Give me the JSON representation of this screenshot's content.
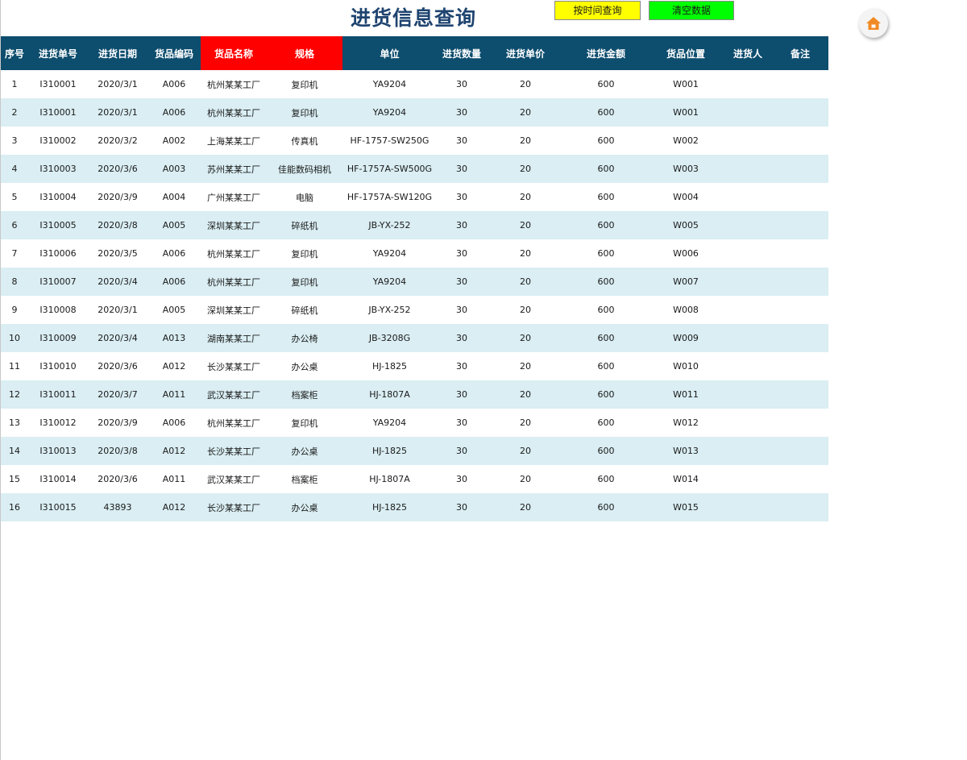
{
  "title": "进货信息查询",
  "buttons": {
    "query_by_time": "按时间查询",
    "clear_data": "清空数据"
  },
  "icons": {
    "home": "home-icon"
  },
  "colors": {
    "title": "#1f4470",
    "header_bg": "#0d4d6e",
    "header_highlight": "#ff0000",
    "stripe": "#daeef3",
    "query_button": "#ffff00",
    "clear_button": "#00ff00",
    "home_icon": "#f08a24"
  },
  "table": {
    "columns": [
      "序号",
      "进货单号",
      "进货日期",
      "货品编码",
      "货品名称",
      "规格",
      "单位",
      "进货数量",
      "进货单价",
      "进货金额",
      "货品位置",
      "进货人",
      "备注"
    ],
    "highlighted_columns": [
      4,
      5
    ],
    "rows": [
      [
        "1",
        "I310001",
        "2020/3/1",
        "A006",
        "杭州某某工厂",
        "复印机",
        "YA9204",
        "30",
        "20",
        "600",
        "W001",
        "",
        ""
      ],
      [
        "2",
        "I310001",
        "2020/3/1",
        "A006",
        "杭州某某工厂",
        "复印机",
        "YA9204",
        "30",
        "20",
        "600",
        "W001",
        "",
        ""
      ],
      [
        "3",
        "I310002",
        "2020/3/2",
        "A002",
        "上海某某工厂",
        "传真机",
        "HF-1757-SW250G",
        "30",
        "20",
        "600",
        "W002",
        "",
        ""
      ],
      [
        "4",
        "I310003",
        "2020/3/6",
        "A003",
        "苏州某某工厂",
        "佳能数码相机",
        "HF-1757A-SW500G",
        "30",
        "20",
        "600",
        "W003",
        "",
        ""
      ],
      [
        "5",
        "I310004",
        "2020/3/9",
        "A004",
        "广州某某工厂",
        "电脑",
        "HF-1757A-SW120G",
        "30",
        "20",
        "600",
        "W004",
        "",
        ""
      ],
      [
        "6",
        "I310005",
        "2020/3/8",
        "A005",
        "深圳某某工厂",
        "碎纸机",
        "JB-YX-252",
        "30",
        "20",
        "600",
        "W005",
        "",
        ""
      ],
      [
        "7",
        "I310006",
        "2020/3/5",
        "A006",
        "杭州某某工厂",
        "复印机",
        "YA9204",
        "30",
        "20",
        "600",
        "W006",
        "",
        ""
      ],
      [
        "8",
        "I310007",
        "2020/3/4",
        "A006",
        "杭州某某工厂",
        "复印机",
        "YA9204",
        "30",
        "20",
        "600",
        "W007",
        "",
        ""
      ],
      [
        "9",
        "I310008",
        "2020/3/1",
        "A005",
        "深圳某某工厂",
        "碎纸机",
        "JB-YX-252",
        "30",
        "20",
        "600",
        "W008",
        "",
        ""
      ],
      [
        "10",
        "I310009",
        "2020/3/4",
        "A013",
        "湖南某某工厂",
        "办公椅",
        "JB-3208G",
        "30",
        "20",
        "600",
        "W009",
        "",
        ""
      ],
      [
        "11",
        "I310010",
        "2020/3/6",
        "A012",
        "长沙某某工厂",
        "办公桌",
        "HJ-1825",
        "30",
        "20",
        "600",
        "W010",
        "",
        ""
      ],
      [
        "12",
        "I310011",
        "2020/3/7",
        "A011",
        "武汉某某工厂",
        "档案柜",
        "HJ-1807A",
        "30",
        "20",
        "600",
        "W011",
        "",
        ""
      ],
      [
        "13",
        "I310012",
        "2020/3/9",
        "A006",
        "杭州某某工厂",
        "复印机",
        "YA9204",
        "30",
        "20",
        "600",
        "W012",
        "",
        ""
      ],
      [
        "14",
        "I310013",
        "2020/3/8",
        "A012",
        "长沙某某工厂",
        "办公桌",
        "HJ-1825",
        "30",
        "20",
        "600",
        "W013",
        "",
        ""
      ],
      [
        "15",
        "I310014",
        "2020/3/6",
        "A011",
        "武汉某某工厂",
        "档案柜",
        "HJ-1807A",
        "30",
        "20",
        "600",
        "W014",
        "",
        ""
      ],
      [
        "16",
        "I310015",
        "43893",
        "A012",
        "长沙某某工厂",
        "办公桌",
        "HJ-1825",
        "30",
        "20",
        "600",
        "W015",
        "",
        ""
      ]
    ]
  }
}
